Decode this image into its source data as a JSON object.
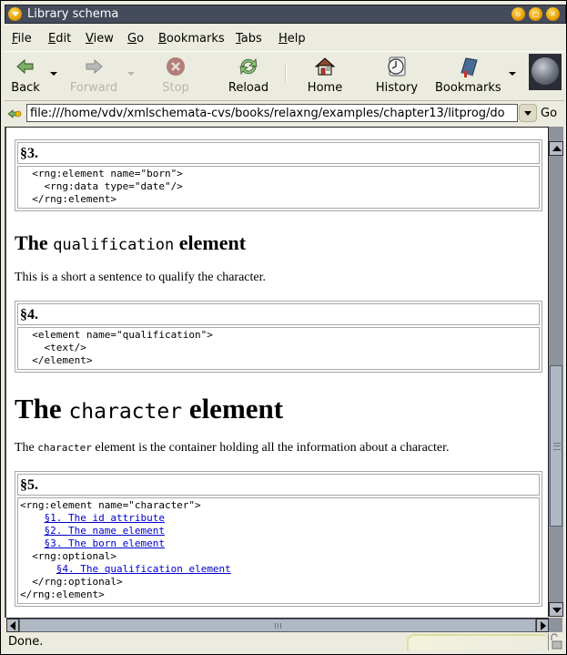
{
  "window": {
    "title": "Library schema"
  },
  "menubar": {
    "items": [
      {
        "label": "File",
        "mnemonic": "F",
        "rest": "ile"
      },
      {
        "label": "Edit",
        "mnemonic": "E",
        "rest": "dit"
      },
      {
        "label": "View",
        "mnemonic": "V",
        "rest": "iew"
      },
      {
        "label": "Go",
        "mnemonic": "G",
        "rest": "o"
      },
      {
        "label": "Bookmarks",
        "mnemonic": "B",
        "rest": "ookmarks"
      },
      {
        "label": "Tabs",
        "mnemonic": "T",
        "rest": "abs"
      },
      {
        "label": "Help",
        "mnemonic": "H",
        "rest": "elp"
      }
    ]
  },
  "toolbar": {
    "back": {
      "label": "Back",
      "icon": "back-arrow-icon",
      "enabled": true
    },
    "forward": {
      "label": "Forward",
      "icon": "forward-arrow-icon",
      "enabled": false
    },
    "stop": {
      "label": "Stop",
      "icon": "stop-icon",
      "enabled": false
    },
    "reload": {
      "label": "Reload",
      "icon": "reload-icon",
      "enabled": true
    },
    "home": {
      "label": "Home",
      "icon": "home-icon",
      "enabled": true
    },
    "history": {
      "label": "History",
      "icon": "history-clock-icon",
      "enabled": true
    },
    "bookmarks": {
      "label": "Bookmarks",
      "icon": "bookmarks-book-icon",
      "enabled": true
    }
  },
  "location": {
    "url": "file:///home/vdv/xmlschemata-cvs/books/relaxng/examples/chapter13/litprog/do",
    "go_label": "Go"
  },
  "content": {
    "section3": {
      "heading": "§3.",
      "code": "  <rng:element name=\"born\">\n    <rng:data type=\"date\"/>\n  </rng:element>"
    },
    "qualification_heading": {
      "pre": "The ",
      "code": "qualification",
      "post": " element"
    },
    "qualification_para": "This is a short a sentence to qualify the character.",
    "section4": {
      "heading": "§4.",
      "code": "  <element name=\"qualification\">\n    <text/>\n  </element>"
    },
    "character_heading": {
      "pre": "The ",
      "code": "character",
      "post": " element"
    },
    "character_para": {
      "pre": "The ",
      "code": "character",
      "post": " element is the container holding all the information about a character."
    },
    "section5": {
      "heading": "§5.",
      "line1": "<rng:element name=\"character\">",
      "link1": "§1. The id attribute",
      "link2": "§2. The name element",
      "link3": "§3. The born element",
      "optional_open": "  <rng:optional>",
      "link4": "§4. The qualification element",
      "optional_close": "  </rng:optional>",
      "line_last": "</rng:element>"
    }
  },
  "scroll": {
    "vertical_thumb_start_fraction": 0.47,
    "vertical_thumb_end_fraction": 0.83,
    "horizontal_thumb_fraction": 1.0
  },
  "status": {
    "text": "Done."
  },
  "colors": {
    "link": "#0000cc",
    "chrome": "#ecebdf",
    "titlebar": "#4a5263"
  }
}
